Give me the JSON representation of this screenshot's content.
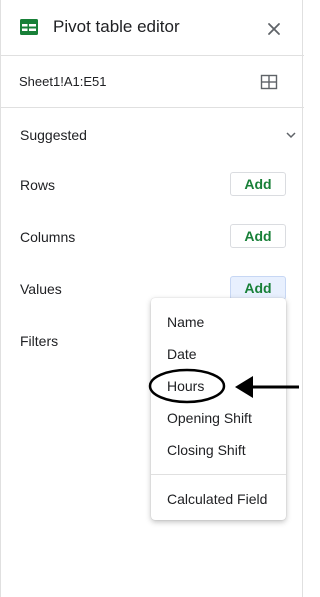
{
  "header": {
    "title": "Pivot table editor",
    "icon": "sheets-table-icon",
    "close_icon": "close-icon"
  },
  "range": {
    "value": "Sheet1!A1:E51",
    "icon": "grid-select-icon"
  },
  "sections": {
    "suggested": "Suggested",
    "rows": "Rows",
    "columns": "Columns",
    "values": "Values",
    "filters": "Filters"
  },
  "buttons": {
    "rows_add": "Add",
    "columns_add": "Add",
    "values_add": "Add"
  },
  "menu": {
    "items": [
      "Name",
      "Date",
      "Hours",
      "Opening Shift",
      "Closing Shift"
    ],
    "footer_item": "Calculated Field",
    "highlighted": "Hours"
  },
  "colors": {
    "accent_green": "#188038",
    "active_button_bg": "#e8f0fe",
    "divider": "#e0e0e0",
    "annotation": "#000000"
  }
}
